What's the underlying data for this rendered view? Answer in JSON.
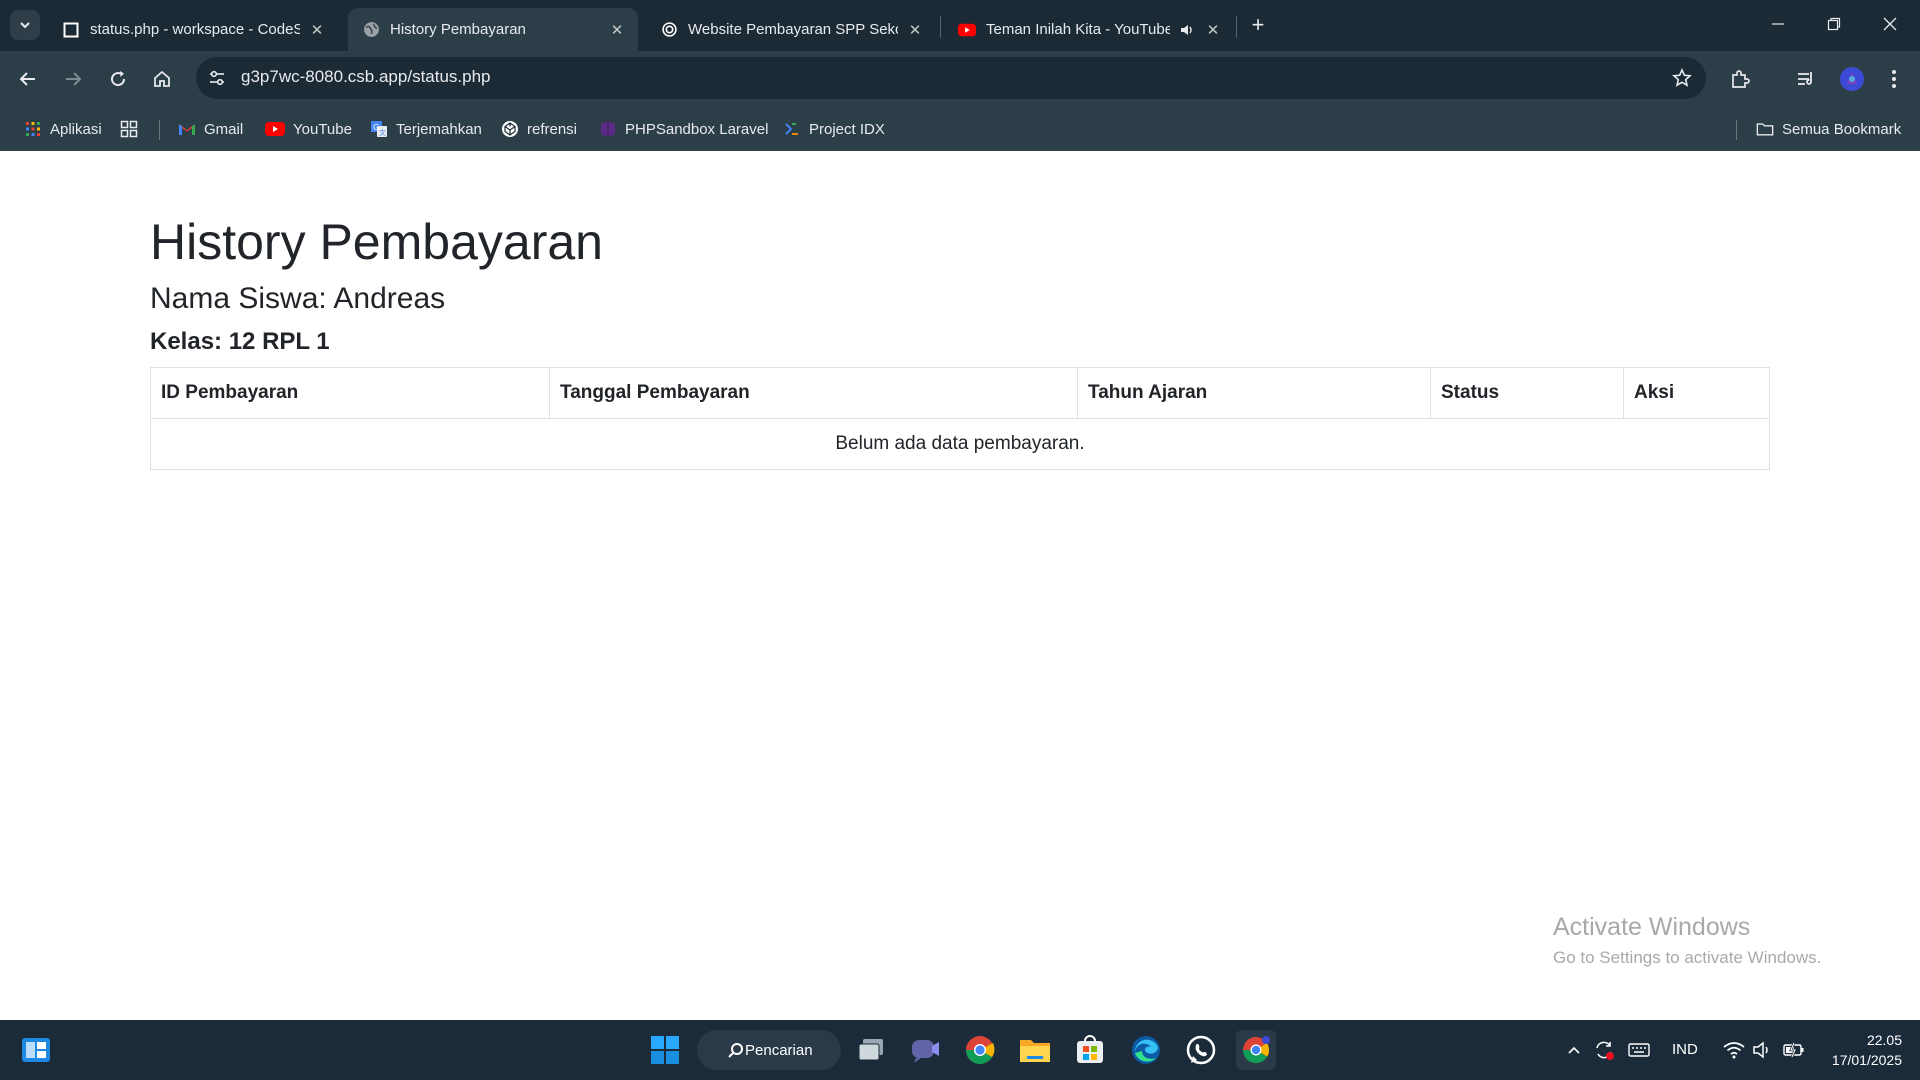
{
  "browser": {
    "tabs": [
      {
        "title": "status.php - workspace - CodeSandbox",
        "active": false
      },
      {
        "title": "History Pembayaran",
        "active": true
      },
      {
        "title": "Website Pembayaran SPP Sekolah",
        "active": false
      },
      {
        "title": "Teman Inilah Kita - YouTube",
        "active": false
      }
    ],
    "address": "g3p7wc-8080.csb.app/status.php",
    "bookmarks": {
      "apps": "Aplikasi",
      "gmail": "Gmail",
      "youtube": "YouTube",
      "translate": "Terjemahkan",
      "refrensi": "refrensi",
      "phpsandbox": "PHPSandbox Laravel",
      "idx": "Project IDX",
      "all": "Semua Bookmark"
    },
    "accent": "#2c3e48"
  },
  "page": {
    "title": "History Pembayaran",
    "student": "Nama Siswa: Andreas",
    "class": "Kelas: 12 RPL 1",
    "table": {
      "headers": [
        "ID Pembayaran",
        "Tanggal Pembayaran",
        "Tahun Ajaran",
        "Status",
        "Aksi"
      ],
      "empty_message": "Belum ada data pembayaran."
    }
  },
  "watermark": {
    "line1": "Activate Windows",
    "line2": "Go to Settings to activate Windows."
  },
  "taskbar": {
    "search": "Pencarian",
    "language": "IND",
    "time": "22.05",
    "date": "17/01/2025"
  }
}
